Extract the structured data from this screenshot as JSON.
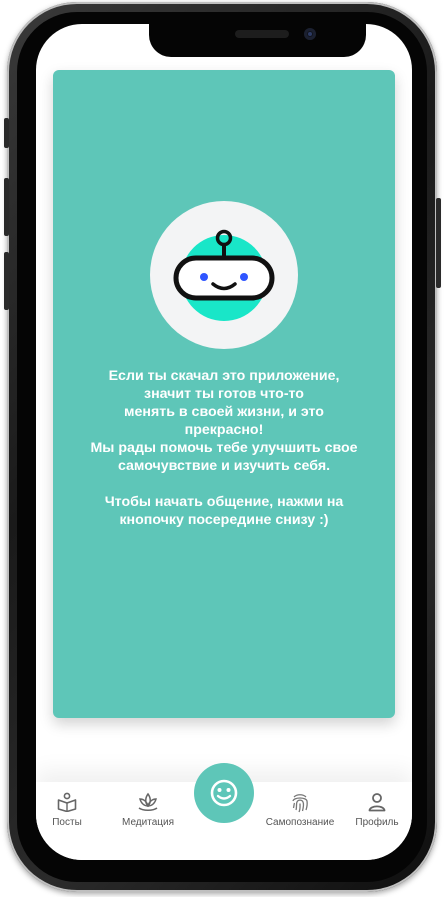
{
  "card": {
    "background": "#5ec6b8",
    "avatar_icon": "robot-icon",
    "message": "Если ты скачал это приложение,\nзначит ты готов что-то\nменять в своей жизни, и это\nпрекрасно!\nМы рады помочь тебе улучшить свое\nсамочувствие и изучить себя.\n\nЧтобы начать общение, нажми на\nкнопочку посередине снизу :)"
  },
  "tabbar": {
    "items": [
      {
        "label": "Посты",
        "icon": "book-icon"
      },
      {
        "label": "Медитация",
        "icon": "lotus-icon"
      },
      {
        "label": "",
        "icon": "smile-icon"
      },
      {
        "label": "Самопознание",
        "icon": "fingerprint-icon"
      },
      {
        "label": "Профиль",
        "icon": "user-icon"
      }
    ],
    "accent": "#5ec6b8"
  }
}
